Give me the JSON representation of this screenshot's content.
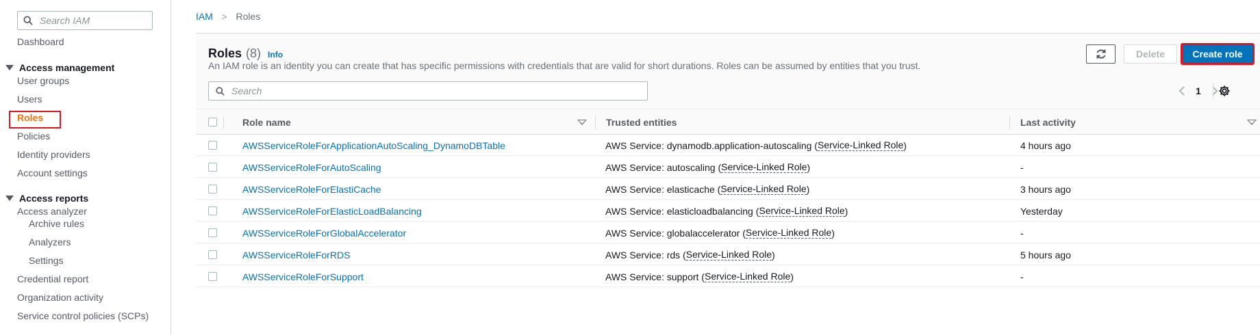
{
  "sidebar": {
    "search_placeholder": "Search IAM",
    "dashboard": "Dashboard",
    "access_management": {
      "label": "Access management",
      "items": [
        "User groups",
        "Users",
        "Roles",
        "Policies",
        "Identity providers",
        "Account settings"
      ]
    },
    "access_reports": {
      "label": "Access reports",
      "analyzer": "Access analyzer",
      "analyzer_items": [
        "Archive rules",
        "Analyzers",
        "Settings"
      ],
      "items": [
        "Credential report",
        "Organization activity",
        "Service control policies (SCPs)"
      ]
    },
    "active_item": "Roles",
    "active_color": "#ec7211"
  },
  "breadcrumb": {
    "root": "IAM",
    "separator": ">",
    "current": "Roles"
  },
  "panel": {
    "title": "Roles",
    "count": "(8)",
    "info": "Info",
    "description": "An IAM role is an identity you can create that has specific permissions with credentials that are valid for short durations. Roles can be assumed by entities that you trust.",
    "refresh_icon": "refresh-icon",
    "delete_label": "Delete",
    "create_label": "Create role",
    "search_placeholder": "Search",
    "page": "1",
    "settings_icon": "gear-icon",
    "accent_color": "#0073bb"
  },
  "table": {
    "columns": {
      "role_name": "Role name",
      "trusted_entities": "Trusted entities",
      "last_activity": "Last activity"
    },
    "rows": [
      {
        "name": "AWSServiceRoleForApplicationAutoScaling_DynamoDBTable",
        "trusted_prefix": "AWS Service: dynamodb.application-autoscaling (",
        "slr": "Service-Linked Role",
        "trusted_suffix": ")",
        "activity": "4 hours ago"
      },
      {
        "name": "AWSServiceRoleForAutoScaling",
        "trusted_prefix": "AWS Service: autoscaling (",
        "slr": "Service-Linked Role",
        "trusted_suffix": ")",
        "activity": "-"
      },
      {
        "name": "AWSServiceRoleForElastiCache",
        "trusted_prefix": "AWS Service: elasticache (",
        "slr": "Service-Linked Role",
        "trusted_suffix": ")",
        "activity": "3 hours ago"
      },
      {
        "name": "AWSServiceRoleForElasticLoadBalancing",
        "trusted_prefix": "AWS Service: elasticloadbalancing (",
        "slr": "Service-Linked Role",
        "trusted_suffix": ")",
        "activity": "Yesterday"
      },
      {
        "name": "AWSServiceRoleForGlobalAccelerator",
        "trusted_prefix": "AWS Service: globalaccelerator (",
        "slr": "Service-Linked Role",
        "trusted_suffix": ")",
        "activity": "-"
      },
      {
        "name": "AWSServiceRoleForRDS",
        "trusted_prefix": "AWS Service: rds (",
        "slr": "Service-Linked Role",
        "trusted_suffix": ")",
        "activity": "5 hours ago"
      },
      {
        "name": "AWSServiceRoleForSupport",
        "trusted_prefix": "AWS Service: support (",
        "slr": "Service-Linked Role",
        "trusted_suffix": ")",
        "activity": "-"
      }
    ]
  },
  "highlight_color": "#e0141e"
}
